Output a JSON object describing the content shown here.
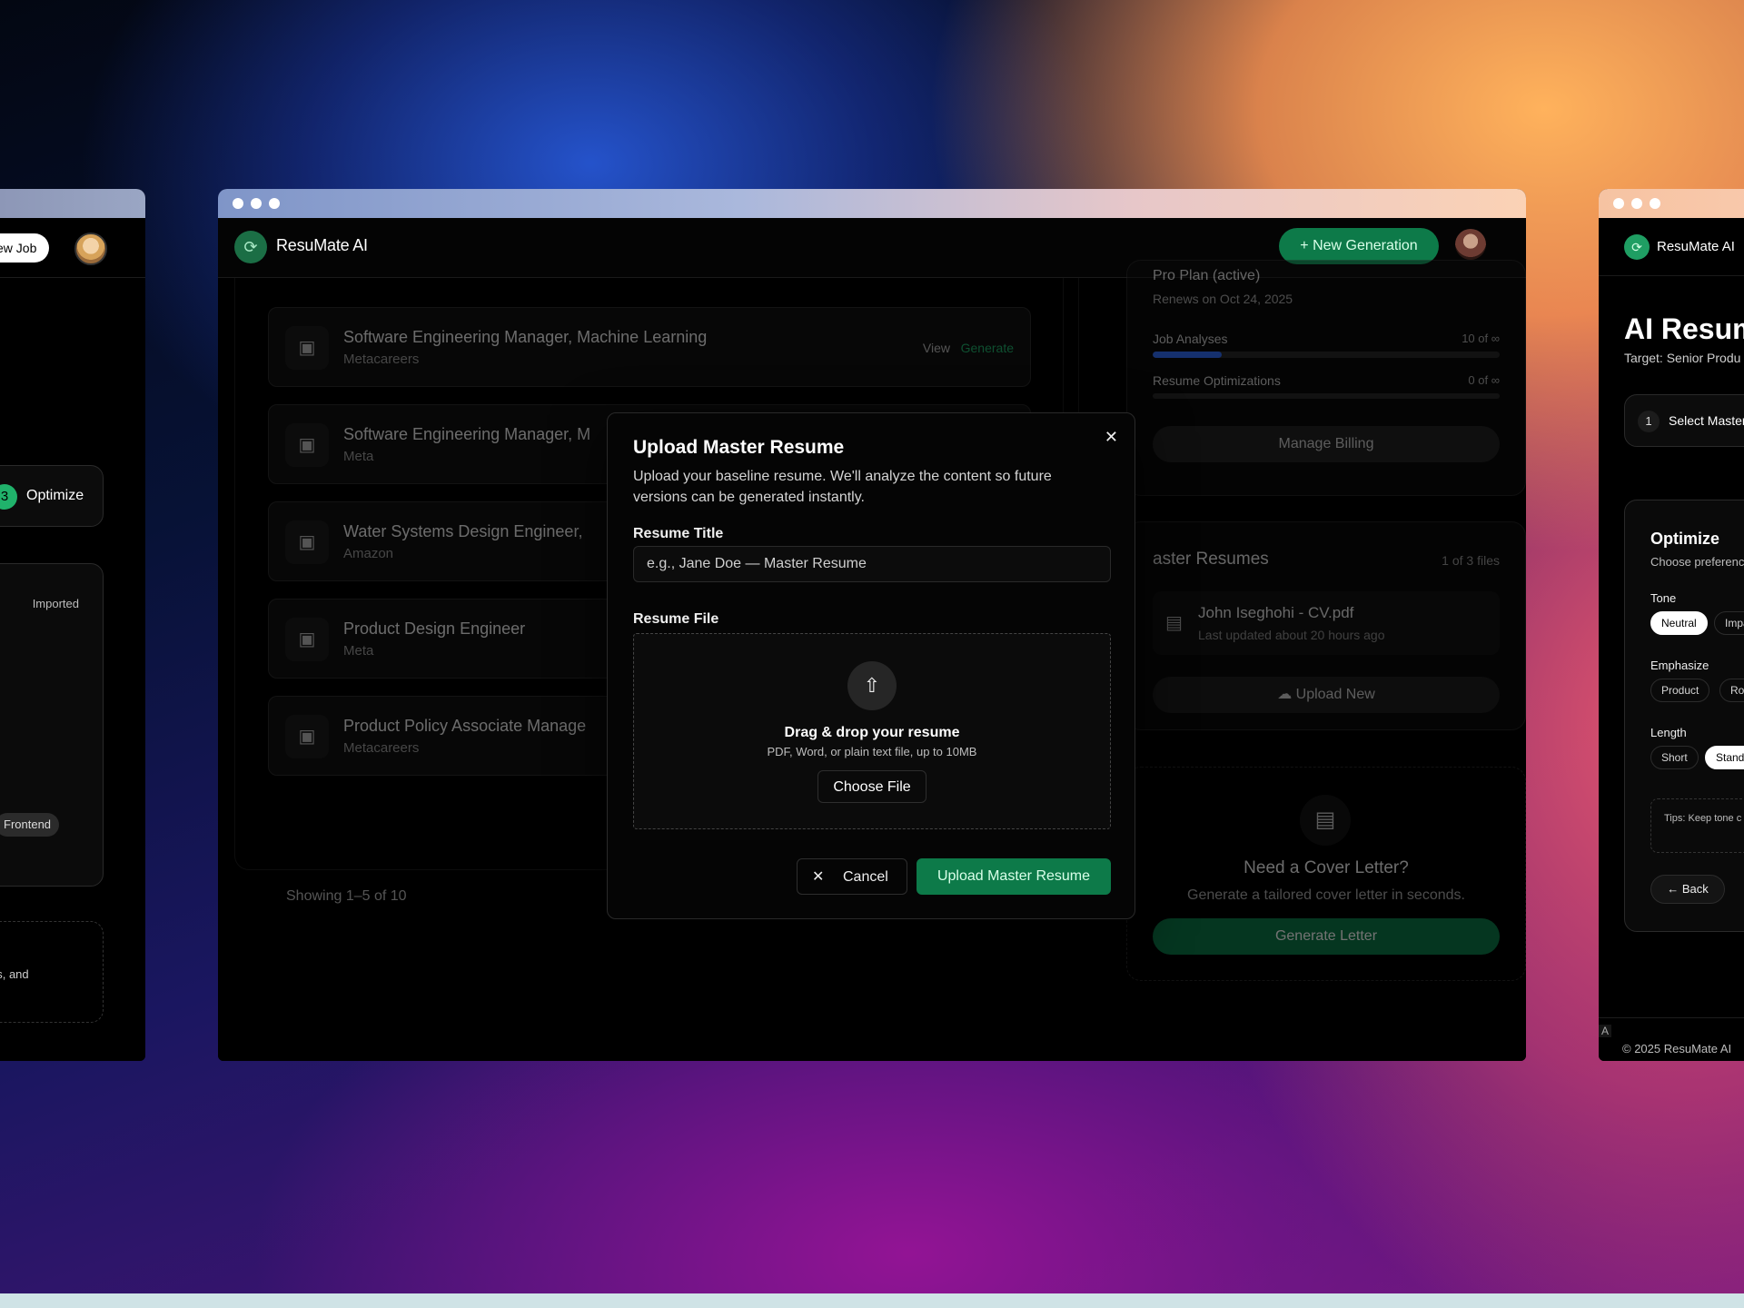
{
  "left_window": {
    "new_job_label": "ew Job",
    "step_number": "3",
    "step_label": "Optimize",
    "imported_label": "Imported",
    "frontend_tag": "Frontend",
    "dashed_text": "es, and"
  },
  "center_window": {
    "brand": "ResuMate AI",
    "new_generation_label": "New Generation",
    "jobs": [
      {
        "title": "Software Engineering Manager, Machine Learning",
        "company": "Metacareers",
        "view": "View",
        "generate": "Generate"
      },
      {
        "title": "Software Engineering Manager, M",
        "company": "Meta"
      },
      {
        "title": "Water Systems Design Engineer,",
        "company": "Amazon"
      },
      {
        "title": "Product Design Engineer",
        "company": "Meta"
      },
      {
        "title": "Product Policy Associate Manage",
        "company": "Metacareers"
      }
    ],
    "showing": "Showing 1–5 of 10",
    "plan": {
      "name": "Pro Plan (active)",
      "renews": "Renews on Oct 24, 2025",
      "job_analyses_label": "Job Analyses",
      "job_analyses_value": "10 of ∞",
      "job_analyses_fill": 0.2,
      "resume_opt_label": "Resume Optimizations",
      "resume_opt_value": "0 of ∞",
      "resume_opt_fill": 0,
      "manage_billing": "Manage Billing"
    },
    "master_resumes": {
      "heading": "aster Resumes",
      "count": "1 of 3 files",
      "file_name": "John Iseghohi - CV.pdf",
      "file_updated": "Last updated about 20 hours ago",
      "upload_new": "Upload New"
    },
    "cover_letter": {
      "title": "Need a Cover Letter?",
      "subtitle": "Generate a tailored cover letter in seconds.",
      "button": "Generate Letter"
    },
    "modal": {
      "title": "Upload Master Resume",
      "description": "Upload your baseline resume. We'll analyze the content so future versions can be generated instantly.",
      "resume_title_label": "Resume Title",
      "resume_title_placeholder": "e.g., Jane Doe — Master Resume",
      "resume_file_label": "Resume File",
      "drag_drop": "Drag & drop your resume",
      "file_types": "PDF, Word, or plain text file, up to 10MB",
      "choose_file": "Choose File",
      "cancel": "Cancel",
      "submit": "Upload Master Resume"
    }
  },
  "right_window": {
    "brand": "ResuMate AI",
    "title": "AI Resum",
    "target": "Target: Senior Produ",
    "step_number": "1",
    "step_label": "Select Master",
    "optimize_heading": "Optimize",
    "optimize_sub": "Choose preferenc",
    "tone_label": "Tone",
    "tone_options": [
      "Neutral",
      "Impa"
    ],
    "emphasize_label": "Emphasize",
    "emphasize_options": [
      "Product",
      "Roa"
    ],
    "length_label": "Length",
    "length_options": [
      "Short",
      "Standa"
    ],
    "tips": "Tips: Keep tone c oriented.",
    "back": "Back",
    "a_label": "A",
    "copyright": "© 2025 ResuMate AI"
  },
  "colors": {
    "accent_green": "#0d7a49",
    "progress_blue": "#2f6cf6"
  }
}
